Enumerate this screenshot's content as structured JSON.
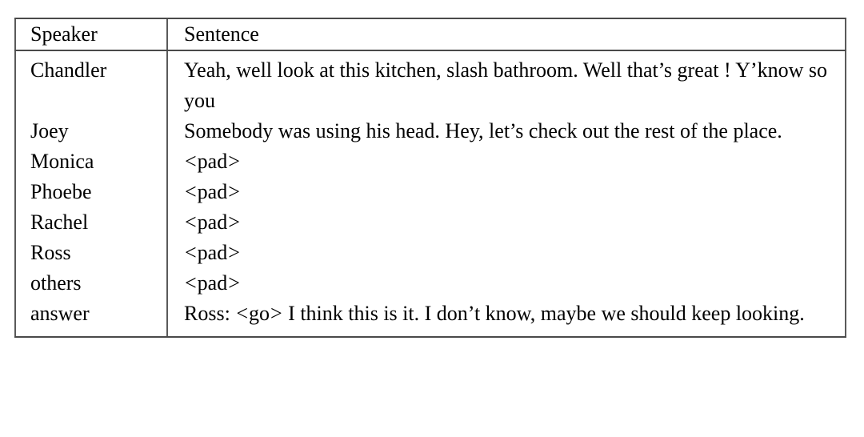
{
  "table": {
    "columns": [
      {
        "key": "speaker",
        "label": "Speaker"
      },
      {
        "key": "sentence",
        "label": "Sentence"
      }
    ],
    "rows": [
      {
        "speaker": "Chandler",
        "sentence": "Yeah, well look at this kitchen, slash bathroom. Well that’s great ! Y’know so you",
        "justified": true
      },
      {
        "speaker": "Joey",
        "sentence": "Somebody was using his head. Hey, let’s check out the rest of the place.",
        "justified": true
      },
      {
        "speaker": "Monica",
        "sentence": "<pad>",
        "justified": false
      },
      {
        "speaker": "Phoebe",
        "sentence": "<pad>",
        "justified": false
      },
      {
        "speaker": "Rachel",
        "sentence": "<pad>",
        "justified": false
      },
      {
        "speaker": "Ross",
        "sentence": "<pad>",
        "justified": false
      },
      {
        "speaker": "others",
        "sentence": "<pad>",
        "justified": false
      },
      {
        "speaker": "answer",
        "sentence": "Ross: <go> I think this is it. I don’t know, maybe we should keep looking.",
        "justified": true
      }
    ]
  },
  "style": {
    "background_color": "#ffffff",
    "text_color": "#000000",
    "rule_color": "#4a4a4a"
  }
}
